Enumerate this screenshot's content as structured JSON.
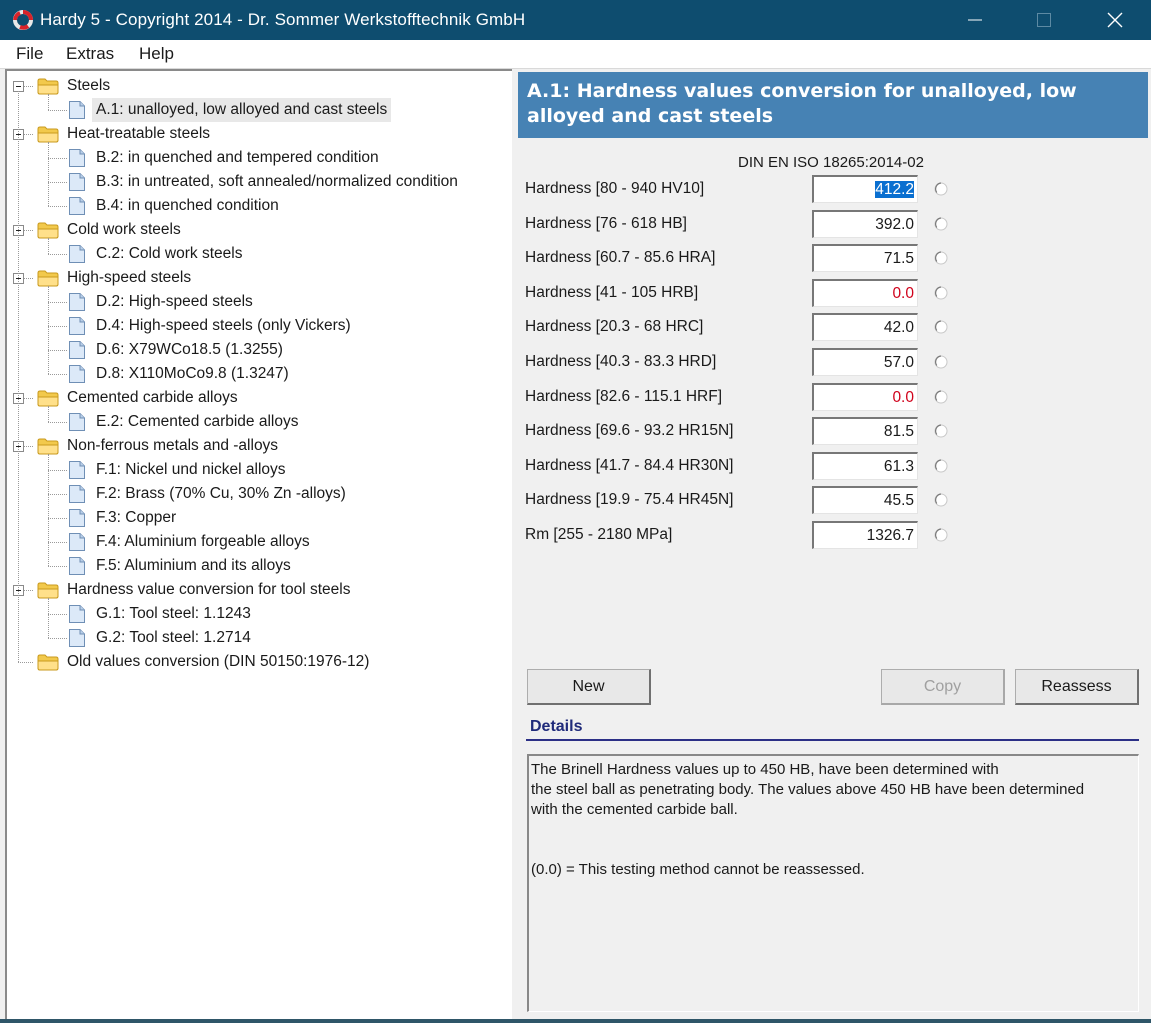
{
  "window": {
    "title": "Hardy 5 - Copyright 2014 - Dr. Sommer Werkstofftechnik GmbH",
    "app_icon": "hardy-logo-icon",
    "controls": [
      "minimize-icon",
      "maximize-icon",
      "close-icon"
    ],
    "title_bar_color": "#0e4d6f"
  },
  "menu": {
    "items": [
      {
        "label": "File"
      },
      {
        "label": "Extras"
      },
      {
        "label": "Help"
      }
    ]
  },
  "tree": {
    "groups": [
      {
        "label": "Steels",
        "expanded": true,
        "children": [
          {
            "label": "A.1: unalloyed, low alloyed and cast steels",
            "selected": true
          }
        ]
      },
      {
        "label": "Heat-treatable steels",
        "expanded": true,
        "children": [
          {
            "label": "B.2: in quenched and tempered condition"
          },
          {
            "label": "B.3: in untreated, soft annealed/normalized condition"
          },
          {
            "label": "B.4: in quenched condition"
          }
        ]
      },
      {
        "label": "Cold work steels",
        "expanded": true,
        "children": [
          {
            "label": "C.2: Cold work steels"
          }
        ]
      },
      {
        "label": "High-speed steels",
        "expanded": true,
        "children": [
          {
            "label": "D.2: High-speed steels"
          },
          {
            "label": "D.4: High-speed steels  (only Vickers)"
          },
          {
            "label": "D.6: X79WCo18.5 (1.3255)"
          },
          {
            "label": "D.8: X110MoCo9.8 (1.3247)"
          }
        ]
      },
      {
        "label": "Cemented carbide alloys",
        "expanded": true,
        "children": [
          {
            "label": "E.2: Cemented carbide alloys"
          }
        ]
      },
      {
        "label": "Non-ferrous metals and -alloys",
        "expanded": true,
        "children": [
          {
            "label": "F.1: Nickel und nickel alloys"
          },
          {
            "label": "F.2: Brass (70% Cu, 30% Zn -alloys)"
          },
          {
            "label": "F.3: Copper"
          },
          {
            "label": "F.4: Aluminium forgeable alloys"
          },
          {
            "label": "F.5: Aluminium and its alloys"
          }
        ]
      },
      {
        "label": "Hardness value conversion for tool steels",
        "expanded": true,
        "children": [
          {
            "label": "G.1: Tool steel: 1.1243"
          },
          {
            "label": "G.2: Tool steel: 1.2714"
          }
        ]
      },
      {
        "label": "Old values conversion (DIN 50150:1976-12)",
        "expanded": null,
        "children": []
      }
    ]
  },
  "panel": {
    "header": "A.1: Hardness values conversion for unalloyed, low alloyed and cast steels",
    "header_color": "#4682b4",
    "standard": "DIN EN ISO 18265:2014-02",
    "rows": [
      {
        "label": "Hardness [80 - 940  HV10]",
        "value": "412.2",
        "selected_text": true,
        "invalid": false
      },
      {
        "label": "Hardness [76 - 618  HB]",
        "value": "392.0",
        "invalid": false
      },
      {
        "label": "Hardness [60.7 - 85.6  HRA]",
        "value": "71.5",
        "invalid": false
      },
      {
        "label": "Hardness [41 - 105  HRB]",
        "value": "0.0",
        "invalid": true
      },
      {
        "label": "Hardness [20.3 - 68  HRC]",
        "value": "42.0",
        "invalid": false
      },
      {
        "label": "Hardness [40.3 - 83.3  HRD]",
        "value": "57.0",
        "invalid": false
      },
      {
        "label": "Hardness [82.6 - 115.1  HRF]",
        "value": "0.0",
        "invalid": true
      },
      {
        "label": "Hardness [69.6 - 93.2  HR15N]",
        "value": "81.5",
        "invalid": false
      },
      {
        "label": "Hardness [41.7 - 84.4  HR30N]",
        "value": "61.3",
        "invalid": false
      },
      {
        "label": "Hardness [19.9 - 75.4  HR45N]",
        "value": "45.5",
        "invalid": false
      },
      {
        "label": "Rm [255 - 2180  MPa]",
        "value": "1326.7",
        "invalid": false
      }
    ],
    "invalid_color": "#d0021b",
    "buttons": {
      "new": "New",
      "copy": "Copy",
      "copy_disabled": true,
      "reassess": "Reassess"
    },
    "details": {
      "title": "Details",
      "text": "The Brinell Hardness values up to 450 HB, have been determined with\nthe steel ball as penetrating body. The values above 450 HB have been determined\nwith the cemented carbide ball.\n\n\n(0.0) = This testing method cannot be reassessed."
    }
  }
}
